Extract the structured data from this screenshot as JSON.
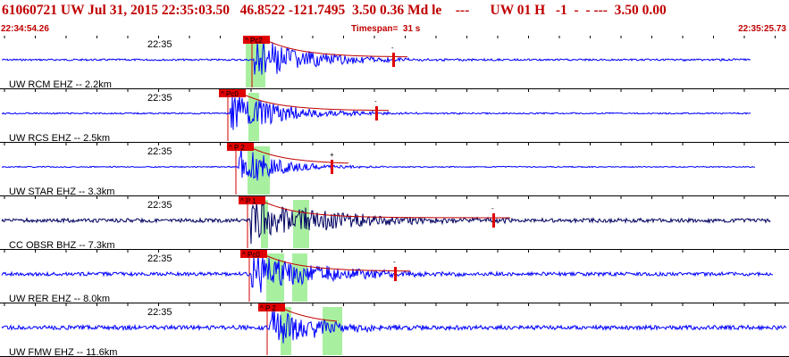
{
  "header": {
    "title": "61060721 UW Jul 31, 2015 22:35:03.50   46.8522 -121.7495  3.50 0.36 Md le    ---      UW 01 H   -1  -  - ---  3.50 0.00",
    "start_time": "22:34:54.26",
    "timespan": "Timespan=  31 s",
    "end_time": "22:35:25.73"
  },
  "colors": {
    "header_text": "#c00000",
    "trace": "#0000ff",
    "trace_bhz": "#000060",
    "pick_box": "#e00000",
    "window_shade": "#a8f0a0",
    "coda_curve": "#c00000"
  },
  "channels": [
    {
      "label": "UW RCM EHZ -- 2.2km",
      "tick": "22:35",
      "pick": "^ Pc2",
      "coda_mark": "-",
      "trace_color": "#0000ff",
      "amp": 7,
      "onset": 0.05,
      "noise": 1.0,
      "decay": 60
    },
    {
      "label": "UW RCS EHZ -- 2.5km",
      "tick": "22:35",
      "pick": "^ Pc0",
      "coda_mark": "-",
      "trace_color": "#0000ff",
      "amp": 6,
      "onset": 0.05,
      "noise": 0.8,
      "decay": 55
    },
    {
      "label": "UW STAR EHZ -- 3.3km",
      "tick": "22:35",
      "pick": "^ P 2",
      "coda_mark": "+",
      "trace_color": "#0000ff",
      "amp": 7,
      "onset": 0.05,
      "noise": 0.6,
      "decay": 40
    },
    {
      "label": "CC OBSR BHZ -- 7.3km",
      "tick": "22:35",
      "pick": "^ P 1",
      "coda_mark": "-",
      "trace_color": "#000060",
      "amp": 7,
      "onset": 0.35,
      "noise": 2.2,
      "decay": 90
    },
    {
      "label": "UW RER EHZ -- 8.0km",
      "tick": "22:35",
      "pick": "^ Pc0",
      "coda_mark": "-",
      "trace_color": "#0000ff",
      "amp": 7,
      "onset": 0.15,
      "noise": 2.0,
      "decay": 70
    },
    {
      "label": "UW FMW EHZ -- 11.6km",
      "tick": "22:35",
      "pick": "^ P 2",
      "coda_mark": "-",
      "trace_color": "#0000ff",
      "amp": 7,
      "onset": 0.2,
      "noise": 2.4,
      "decay": 50
    }
  ]
}
